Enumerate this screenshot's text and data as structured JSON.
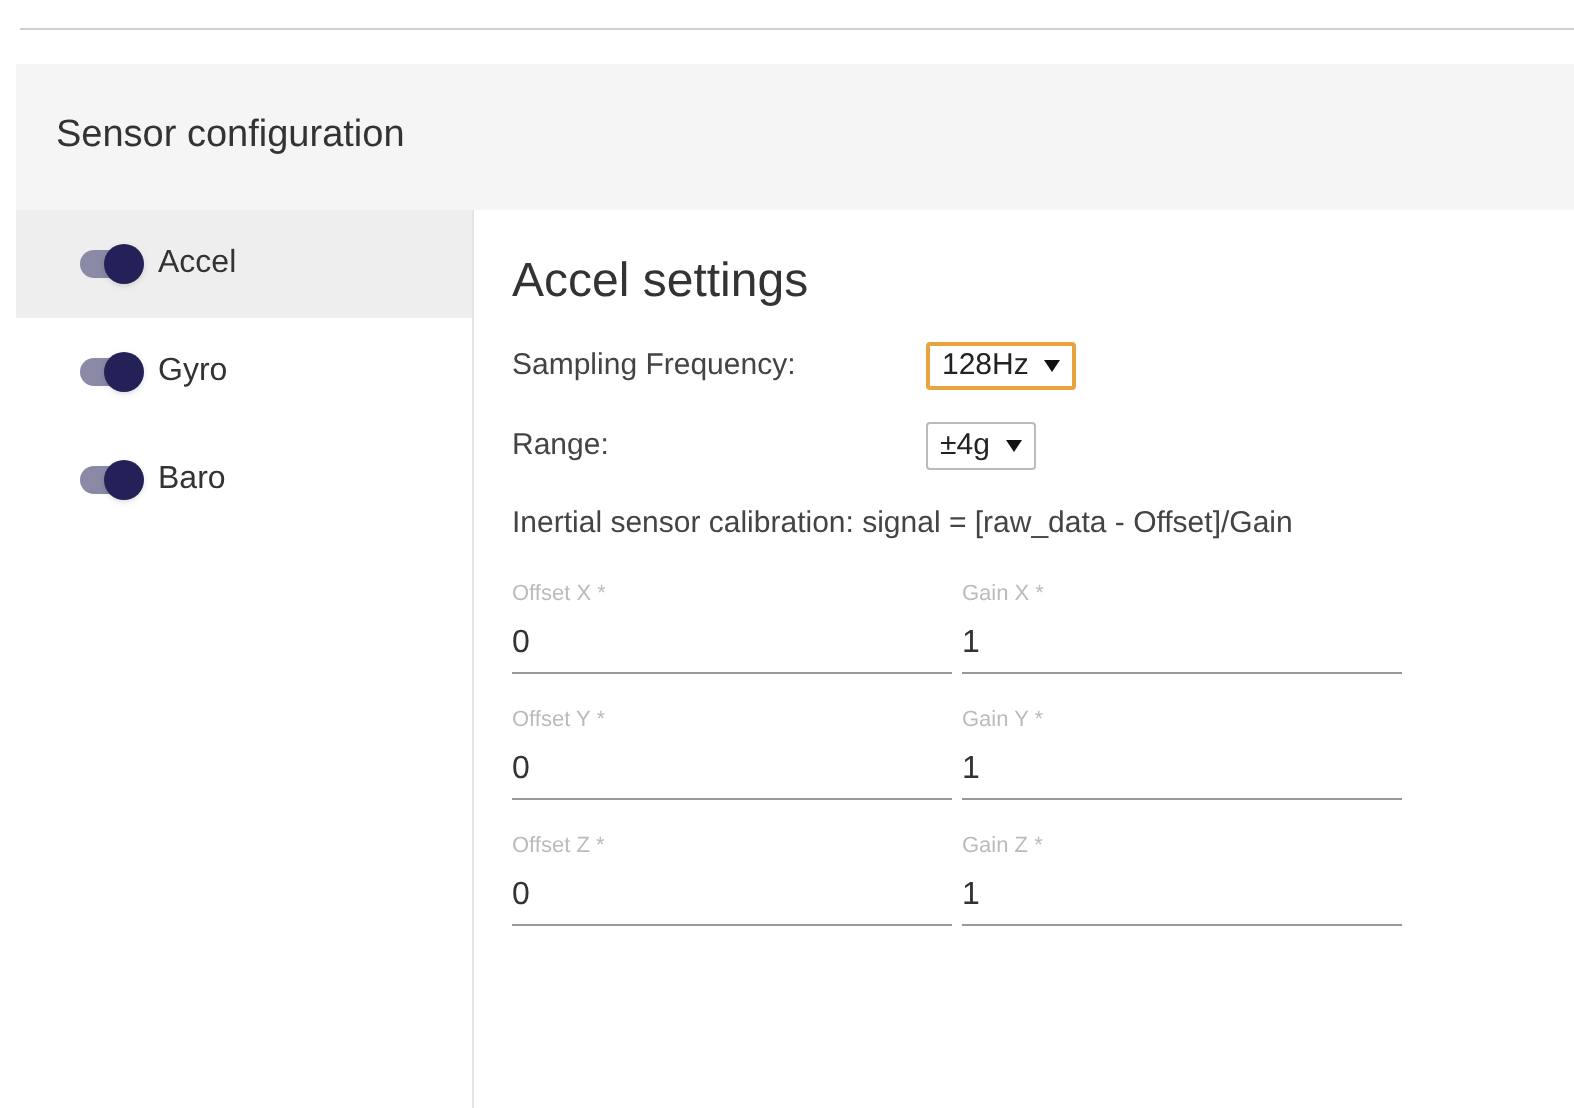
{
  "panel": {
    "title": "Sensor configuration"
  },
  "sensors": [
    {
      "label": "Accel",
      "on": true,
      "selected": true
    },
    {
      "label": "Gyro",
      "on": true,
      "selected": false
    },
    {
      "label": "Baro",
      "on": true,
      "selected": false
    }
  ],
  "settings": {
    "title": "Accel settings",
    "options": [
      {
        "label": "Sampling Frequency:",
        "value": "128Hz",
        "focused": true
      },
      {
        "label": "Range:",
        "value": "±4g",
        "focused": false
      }
    ],
    "calibration_note": "Inertial sensor calibration: signal = [raw_data - Offset]/Gain",
    "fields": [
      {
        "label": "Offset X *",
        "value": "0"
      },
      {
        "label": "Gain X *",
        "value": "1"
      },
      {
        "label": "Offset Y *",
        "value": "0"
      },
      {
        "label": "Gain Y *",
        "value": "1"
      },
      {
        "label": "Offset Z *",
        "value": "0"
      },
      {
        "label": "Gain Z *",
        "value": "1"
      }
    ]
  }
}
